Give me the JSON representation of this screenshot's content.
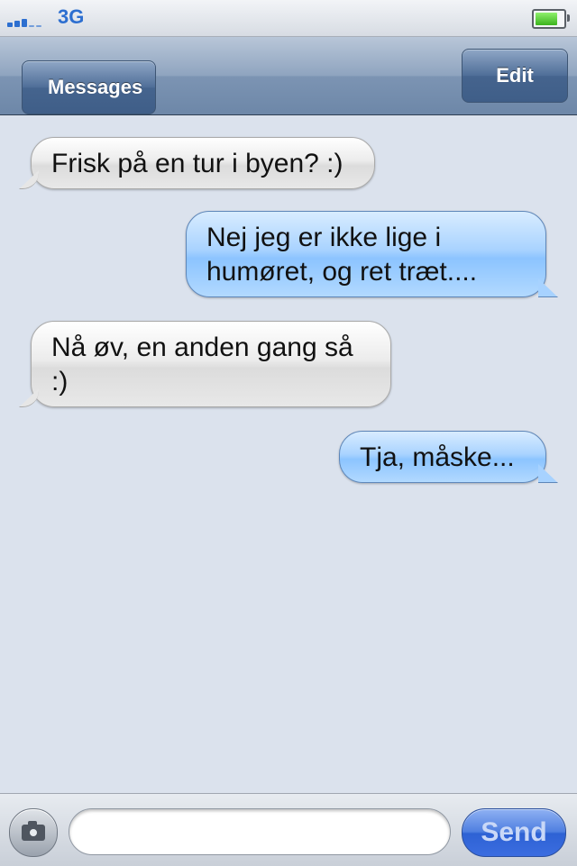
{
  "status_bar": {
    "carrier": "3G",
    "signal_bars_filled": 3,
    "battery_level": 0.8
  },
  "nav": {
    "back_label": "Messages",
    "edit_label": "Edit"
  },
  "messages": [
    {
      "direction": "in",
      "text": "Frisk på en tur i byen? :)"
    },
    {
      "direction": "out",
      "text": "Nej jeg er ikke lige i humøret, og ret træt...."
    },
    {
      "direction": "in",
      "text": "Nå øv, en anden gang så :)"
    },
    {
      "direction": "out",
      "text": "Tja, måske..."
    }
  ],
  "composer": {
    "input_value": "",
    "input_placeholder": "",
    "send_label": "Send",
    "camera_icon": "camera-icon"
  },
  "colors": {
    "background": "#dbe2ed",
    "incoming_bubble": "#e6e6e6",
    "outgoing_bubble": "#a9d3ff",
    "send_button": "#2e62d4",
    "nav_bar": "#7c94b3"
  }
}
